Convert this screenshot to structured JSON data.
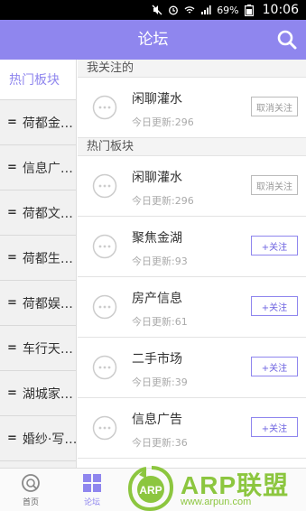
{
  "status_bar": {
    "battery": "69%",
    "time": "10:06"
  },
  "header": {
    "title": "论坛"
  },
  "sidebar": {
    "items": [
      {
        "label": "热门板块",
        "prefix": ""
      },
      {
        "label": "荷都金…",
        "prefix": "="
      },
      {
        "label": "信息广…",
        "prefix": "="
      },
      {
        "label": "荷都文…",
        "prefix": "="
      },
      {
        "label": "荷都生…",
        "prefix": "="
      },
      {
        "label": "荷都娱…",
        "prefix": "="
      },
      {
        "label": "车行天…",
        "prefix": "="
      },
      {
        "label": "湖城家…",
        "prefix": "="
      },
      {
        "label": "婚纱·写…",
        "prefix": "="
      }
    ]
  },
  "main": {
    "followed_section": {
      "title": "我关注的",
      "rows": [
        {
          "name": "闲聊灌水",
          "meta": "今日更新:296",
          "button": "取消关注",
          "followed": true
        }
      ]
    },
    "hot_section": {
      "title": "热门板块",
      "rows": [
        {
          "name": "闲聊灌水",
          "meta": "今日更新:296",
          "button": "取消关注",
          "followed": true
        },
        {
          "name": "聚焦金湖",
          "meta": "今日更新:93",
          "button": "+关注",
          "followed": false
        },
        {
          "name": "房产信息",
          "meta": "今日更新:61",
          "button": "+关注",
          "followed": false
        },
        {
          "name": "二手市场",
          "meta": "今日更新:39",
          "button": "+关注",
          "followed": false
        },
        {
          "name": "信息广告",
          "meta": "今日更新:36",
          "button": "+关注",
          "followed": false
        }
      ]
    }
  },
  "tabbar": {
    "tabs": [
      {
        "label": "首页",
        "icon": "home-icon"
      },
      {
        "label": "论坛",
        "icon": "forum-grid-icon"
      }
    ]
  },
  "watermark": {
    "logo": "ARP联盟",
    "badge": "ARP",
    "url": "www.arpun.com"
  },
  "colors": {
    "accent": "#8f86ee",
    "watermark": "#8cc63f"
  }
}
